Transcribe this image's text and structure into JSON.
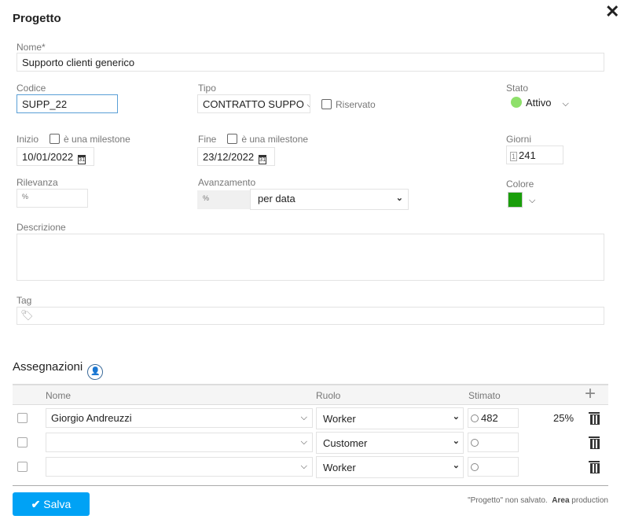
{
  "title": "Progetto",
  "close_icon": "close-icon",
  "fields": {
    "nome": {
      "label": "Nome*",
      "value": "Supporto clienti generico"
    },
    "codice": {
      "label": "Codice",
      "value": "SUPP_22"
    },
    "tipo": {
      "label": "Tipo",
      "value": "CONTRATTO SUPPO"
    },
    "riservato": {
      "label": "Riservato",
      "checked": false
    },
    "stato": {
      "label": "Stato",
      "value": "Attivo",
      "color": "#8ee06a"
    },
    "inizio": {
      "label": "Inizio",
      "milestone_label": "è una milestone",
      "value": "10/01/2022"
    },
    "fine": {
      "label": "Fine",
      "milestone_label": "è una milestone",
      "value": "23/12/2022"
    },
    "giorni": {
      "label": "Giorni",
      "value": "241"
    },
    "rilevanza": {
      "label": "Rilevanza",
      "value": ""
    },
    "avanzamento": {
      "label": "Avanzamento",
      "value": "",
      "mode": "per data"
    },
    "colore": {
      "label": "Colore",
      "value": "#1a9e0b"
    },
    "descrizione": {
      "label": "Descrizione",
      "value": ""
    },
    "tag": {
      "label": "Tag",
      "value": ""
    }
  },
  "assignments": {
    "title": "Assegnazioni",
    "headers": {
      "nome": "Nome",
      "ruolo": "Ruolo",
      "stimato": "Stimato"
    },
    "rows": [
      {
        "nome": "Giorgio Andreuzzi",
        "ruolo": "Worker",
        "stimato": "482",
        "percent": "25%"
      },
      {
        "nome": "",
        "ruolo": "Customer",
        "stimato": "",
        "percent": ""
      },
      {
        "nome": "",
        "ruolo": "Worker",
        "stimato": "",
        "percent": ""
      }
    ]
  },
  "footer": {
    "save_label": "Salva",
    "status": "\"Progetto\" non salvato.",
    "area_label": "Area",
    "area_value": "production",
    "accent": "#00a2f5"
  }
}
